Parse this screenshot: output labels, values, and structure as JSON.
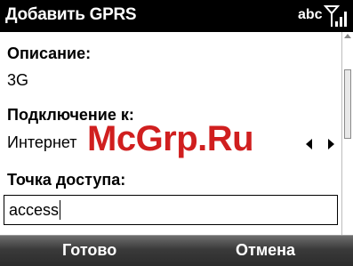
{
  "titlebar": {
    "title": "Добавить GPRS",
    "input_mode": "abc",
    "signal_icon": "signal-bars-icon"
  },
  "form": {
    "description_label": "Описание:",
    "description_value": "3G",
    "connection_label": "Подключение к:",
    "connection_value": "Интернет",
    "connection_arrows_icon": "left-right-arrows-icon",
    "apn_label": "Точка доступа:",
    "apn_value": "access"
  },
  "softkeys": {
    "left": "Готово",
    "right": "Отмена"
  },
  "watermark": "McGrp.Ru",
  "colors": {
    "titlebar_bg": "#000000",
    "softkey_bg": "#3a3a3a",
    "watermark": "#d01f1f"
  }
}
